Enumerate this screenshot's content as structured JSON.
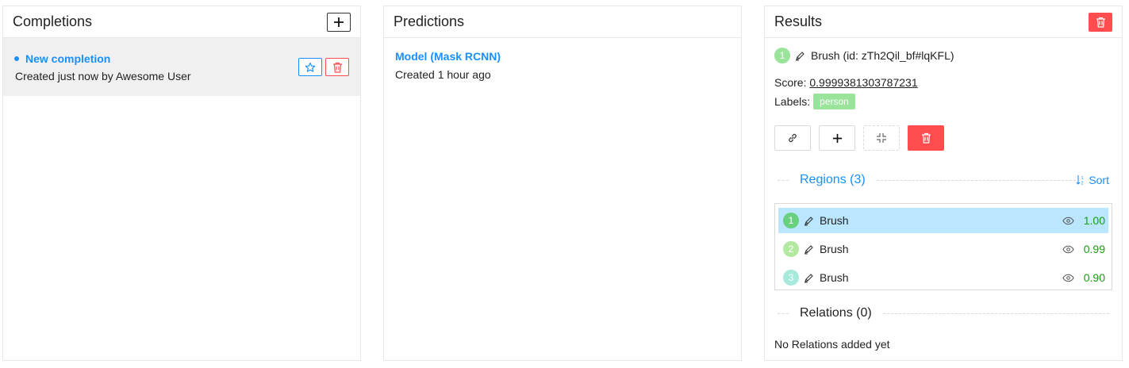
{
  "completions": {
    "title": "Completions",
    "add_icon": "plus-icon",
    "items": [
      {
        "name": "New completion",
        "subtitle": "Created just now by Awesome User"
      }
    ]
  },
  "predictions": {
    "title": "Predictions",
    "items": [
      {
        "name": "Model (Mask RCNN)",
        "subtitle": "Created 1 hour ago"
      }
    ]
  },
  "results": {
    "title": "Results",
    "entity": {
      "index": "1",
      "label": "Brush (id: zTh2Qil_bf#lqKFL)"
    },
    "score_label": "Score:",
    "score_value": "0.9999381303787231",
    "labels_label": "Labels:",
    "label_tag": "person",
    "regions_title": "Regions (3)",
    "sort_label": "Sort",
    "regions": [
      {
        "index": "1",
        "label": "Brush",
        "score": "1.00",
        "color": "#69d07f"
      },
      {
        "index": "2",
        "label": "Brush",
        "score": "0.99",
        "color": "#b3e8a0"
      },
      {
        "index": "3",
        "label": "Brush",
        "score": "0.90",
        "color": "#a7eadc"
      }
    ],
    "relations_title": "Relations (0)",
    "no_relations": "No Relations added yet"
  },
  "colors": {
    "accent": "#1890ff",
    "danger": "#ff4d4f",
    "label_tag": "#9ae39a",
    "selected_region": "#bae7ff",
    "score_green": "#13a10e"
  }
}
